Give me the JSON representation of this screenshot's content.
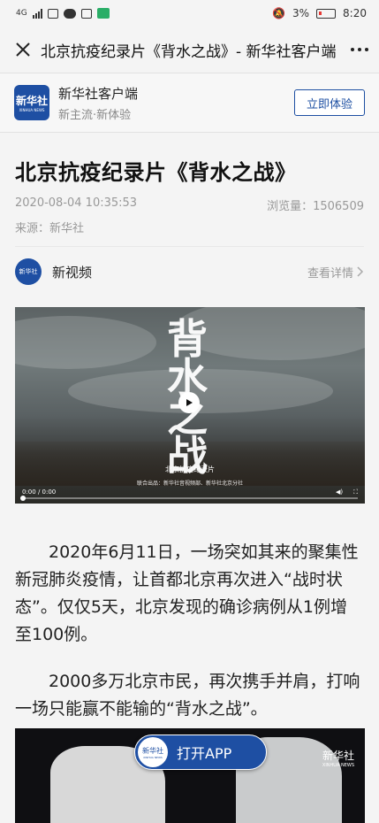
{
  "status_bar": {
    "network": "4G",
    "battery_percent": "3%",
    "time": "8:20"
  },
  "titlebar": {
    "title": "北京抗疫纪录片《背水之战》- 新华社客户端"
  },
  "app_banner": {
    "logo_text": "新华社",
    "logo_en": "XINHUA NEWS",
    "app_name": "新华社客户端",
    "slogan": "新主流·新体验",
    "cta_label": "立即体验"
  },
  "article": {
    "headline": "北京抗疫纪录片《背水之战》",
    "datetime": "2020-08-04 10:35:53",
    "views_label": "浏览量：1506509",
    "source": "来源：新华社",
    "channel": {
      "logo_text": "新华社",
      "name": "新视频",
      "more_label": "查看详情"
    },
    "video": {
      "calligraphy": "背水之战",
      "caption": "北京抗疫纪录片",
      "subcaption": "联合出品：新华社音视频部、新华社北京分社",
      "time": "0:00 / 0:00",
      "progress": 0
    },
    "paragraphs": [
      "2020年6月11日，一场突如其来的聚集性新冠肺炎疫情，让首都北京再次进入“战时状态”。仅仅5天，北京发现的确诊病例从1例增至100例。",
      "2000多万北京市民，再次携手并肩，打响一场只能赢不能输的“背水之战”。"
    ],
    "video2": {
      "logo_text": "新华社",
      "logo_en": "XINHUA NEWS"
    }
  },
  "open_app": {
    "logo_text": "新华社",
    "logo_en": "XINHUA NEWS",
    "label": "打开APP"
  }
}
